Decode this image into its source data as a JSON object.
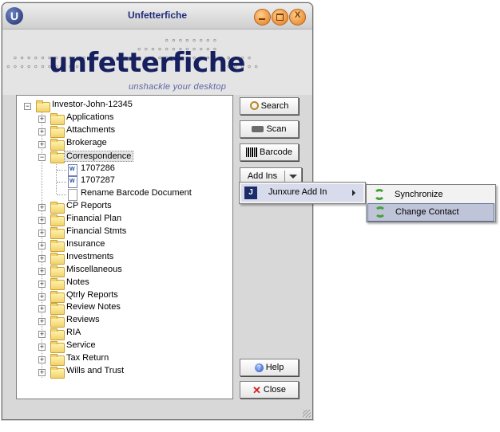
{
  "window": {
    "title": "Unfetterfiche",
    "app_icon": "U",
    "close_glyph": "X"
  },
  "logo": {
    "word": "unfetterfiche",
    "tagline": "unshackle your desktop"
  },
  "tree": {
    "root": "Investor-John-12345",
    "folders": [
      "Applications",
      "Attachments",
      "Brokerage",
      "Correspondence",
      "CP Reports",
      "Financial Plan",
      "Financial Stmts",
      "Insurance",
      "Investments",
      "Miscellaneous",
      "Notes",
      "Qtrly Reports",
      "Review Notes",
      "Reviews",
      "RIA",
      "Service",
      "Tax Return",
      "Wills and Trust"
    ],
    "correspondence_children": [
      "1707286",
      "1707287",
      "Rename Barcode Document"
    ]
  },
  "buttons": {
    "search": "Search",
    "scan": "Scan",
    "barcode": "Barcode",
    "addins": "Add Ins",
    "help": "Help",
    "close": "Close"
  },
  "menu": {
    "item": "Junxure Add In",
    "submenu": [
      "Synchronize",
      "Change Contact"
    ]
  }
}
